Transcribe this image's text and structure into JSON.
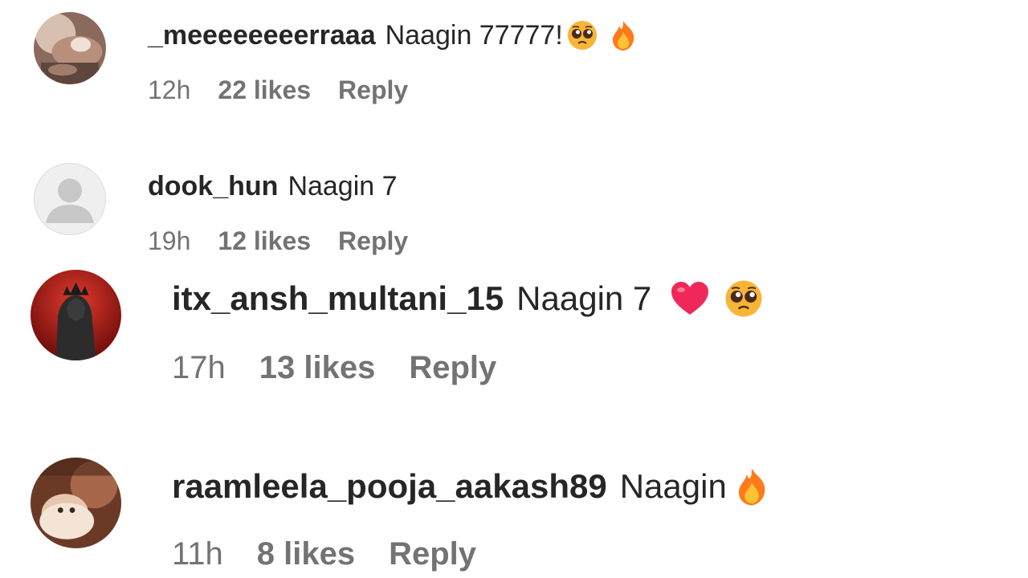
{
  "comments": [
    {
      "username": "_meeeeeeeerraaa",
      "text": "Naagin 77777!",
      "emojis": [
        "pleading-face-emoji",
        "fire-emoji"
      ],
      "time": "12h",
      "likes": "22 likes",
      "reply": "Reply",
      "avatar": "photo-avatar"
    },
    {
      "username": "dook_hun",
      "text": "Naagin 7",
      "emojis": [],
      "time": "19h",
      "likes": "12 likes",
      "reply": "Reply",
      "avatar": "default-user-avatar"
    },
    {
      "username": "itx_ansh_multani_15",
      "text": "Naagin 7",
      "emojis": [
        "heart-emoji",
        "pleading-face-emoji"
      ],
      "time": "17h",
      "likes": "13 likes",
      "reply": "Reply",
      "avatar": "photo-avatar"
    },
    {
      "username": "raamleela_pooja_aakash89",
      "text": "Naagin",
      "emojis": [
        "fire-emoji"
      ],
      "time": "11h",
      "likes": "8 likes",
      "reply": "Reply",
      "avatar": "photo-avatar"
    }
  ],
  "colors": {
    "username": "#262626",
    "meta": "#737373",
    "background": "#ffffff",
    "heart": "#f0285a",
    "fire": "#ff7a1a",
    "emoji_face": "#f7b538"
  }
}
